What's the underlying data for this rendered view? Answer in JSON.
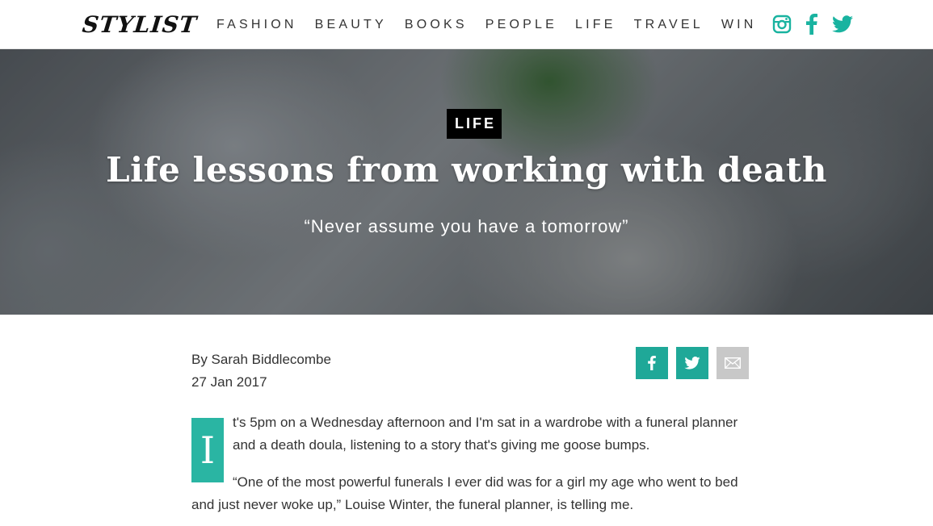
{
  "header": {
    "logo": "STYLIST",
    "nav": [
      "FASHION",
      "BEAUTY",
      "BOOKS",
      "PEOPLE",
      "LIFE",
      "TRAVEL",
      "WIN"
    ],
    "social_icons": [
      "instagram-icon",
      "facebook-icon",
      "twitter-icon"
    ]
  },
  "hero": {
    "category": "LIFE",
    "title": "Life lessons from working with death",
    "subtitle": "“Never assume you have a tomorrow”"
  },
  "article": {
    "author": "By Sarah Biddlecombe",
    "date": "27 Jan 2017",
    "share_buttons": [
      "facebook-icon",
      "twitter-icon",
      "email-icon"
    ],
    "dropcap": "I",
    "paragraph1": "t's 5pm on a Wednesday afternoon and I'm sat in a wardrobe with a funeral planner and a death doula, listening to a story that's giving me goose bumps.",
    "paragraph2": "“One of the most powerful funerals I ever did was for a girl my age who went to bed and just never woke up,” Louise Winter, the funeral planner, is telling me."
  },
  "colors": {
    "accent": "#2ab5a3",
    "tag_background": "#000000",
    "email_button": "#c8c8c8"
  }
}
